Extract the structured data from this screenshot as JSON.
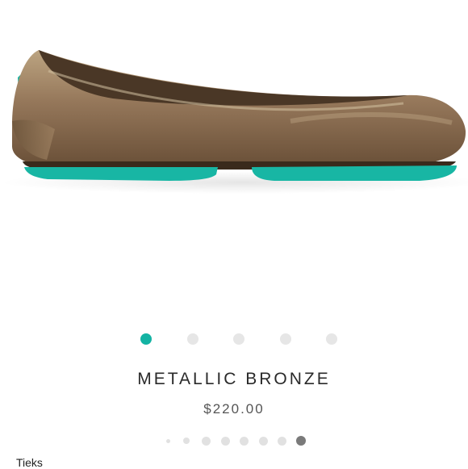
{
  "product": {
    "name": "METALLIC BRONZE",
    "price": "$220.00",
    "image_alt": "Metallic bronze leather ballet flat with teal sole"
  },
  "carousel": {
    "count": 5,
    "active_index": 0,
    "active_color": "#13b3a3",
    "inactive_color": "#e6e6e6"
  },
  "listing_pager": {
    "count": 8,
    "active_index": 7
  },
  "brand": "Tieks",
  "colors": {
    "leather": "#8e7050",
    "sole": "#18b6a4"
  }
}
